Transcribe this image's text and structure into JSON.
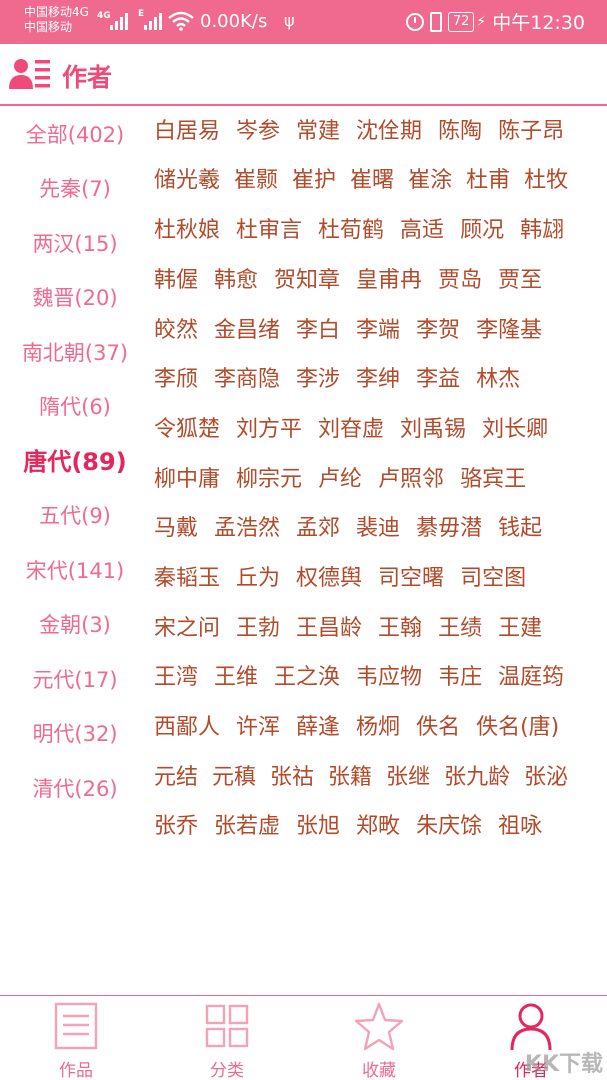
{
  "status_bar": {
    "carrier_1": "中国移动4G",
    "carrier_2": "中国移动",
    "net_tag_1": "4G",
    "net_tag_2": "E",
    "speed": "0.00K/s",
    "battery": "72",
    "time": "中午12:30",
    "background_color": "#f06a8f"
  },
  "header": {
    "title": "作者",
    "icon": "author-card-icon"
  },
  "sidebar": {
    "categories": [
      {
        "label": "全部(402)"
      },
      {
        "label": "先秦(7)"
      },
      {
        "label": "两汉(15)"
      },
      {
        "label": "魏晋(20)"
      },
      {
        "label": "南北朝(37)"
      },
      {
        "label": "隋代(6)"
      },
      {
        "label": "唐代(89)",
        "active": true
      },
      {
        "label": "五代(9)"
      },
      {
        "label": "宋代(141)"
      },
      {
        "label": "金朝(3)"
      },
      {
        "label": "元代(17)"
      },
      {
        "label": "明代(32)"
      },
      {
        "label": "清代(26)"
      }
    ]
  },
  "authors": {
    "rows": [
      [
        "白居易",
        "岑参",
        "常建",
        "沈佺期",
        "陈陶",
        "陈子昂"
      ],
      [
        "储光羲",
        "崔颢",
        "崔护",
        "崔曙",
        "崔涂",
        "杜甫",
        "杜牧"
      ],
      [
        "杜秋娘",
        "杜审言",
        "杜荀鹤",
        "高适",
        "顾况",
        "韩翃"
      ],
      [
        "韩偓",
        "韩愈",
        "贺知章",
        "皇甫冉",
        "贾岛",
        "贾至"
      ],
      [
        "皎然",
        "金昌绪",
        "李白",
        "李端",
        "李贺",
        "李隆基"
      ],
      [
        "李颀",
        "李商隐",
        "李涉",
        "李绅",
        "李益",
        "林杰"
      ],
      [
        "令狐楚",
        "刘方平",
        "刘昚虚",
        "刘禹锡",
        "刘长卿"
      ],
      [
        "柳中庸",
        "柳宗元",
        "卢纶",
        "卢照邻",
        "骆宾王"
      ],
      [
        "马戴",
        "孟浩然",
        "孟郊",
        "裴迪",
        "綦毋潜",
        "钱起"
      ],
      [
        "秦韬玉",
        "丘为",
        "权德舆",
        "司空曙",
        "司空图"
      ],
      [
        "宋之问",
        "王勃",
        "王昌龄",
        "王翰",
        "王绩",
        "王建"
      ],
      [
        "王湾",
        "王维",
        "王之涣",
        "韦应物",
        "韦庄",
        "温庭筠"
      ],
      [
        "西鄙人",
        "许浑",
        "薛逢",
        "杨炯",
        "佚名",
        "佚名(唐)"
      ],
      [
        "元结",
        "元稹",
        "张祜",
        "张籍",
        "张继",
        "张九龄",
        "张泌"
      ],
      [
        "张乔",
        "张若虚",
        "张旭",
        "郑畋",
        "朱庆馀",
        "祖咏"
      ]
    ],
    "text_color": "#b24b2b"
  },
  "bottom_nav": {
    "items": [
      {
        "label": "作品",
        "icon": "document-list-icon"
      },
      {
        "label": "分类",
        "icon": "grid-icon"
      },
      {
        "label": "收藏",
        "icon": "star-icon"
      },
      {
        "label": "作者",
        "icon": "person-icon",
        "active": true
      }
    ],
    "accent_color": "#f06a8f"
  },
  "watermark": "KK下载"
}
